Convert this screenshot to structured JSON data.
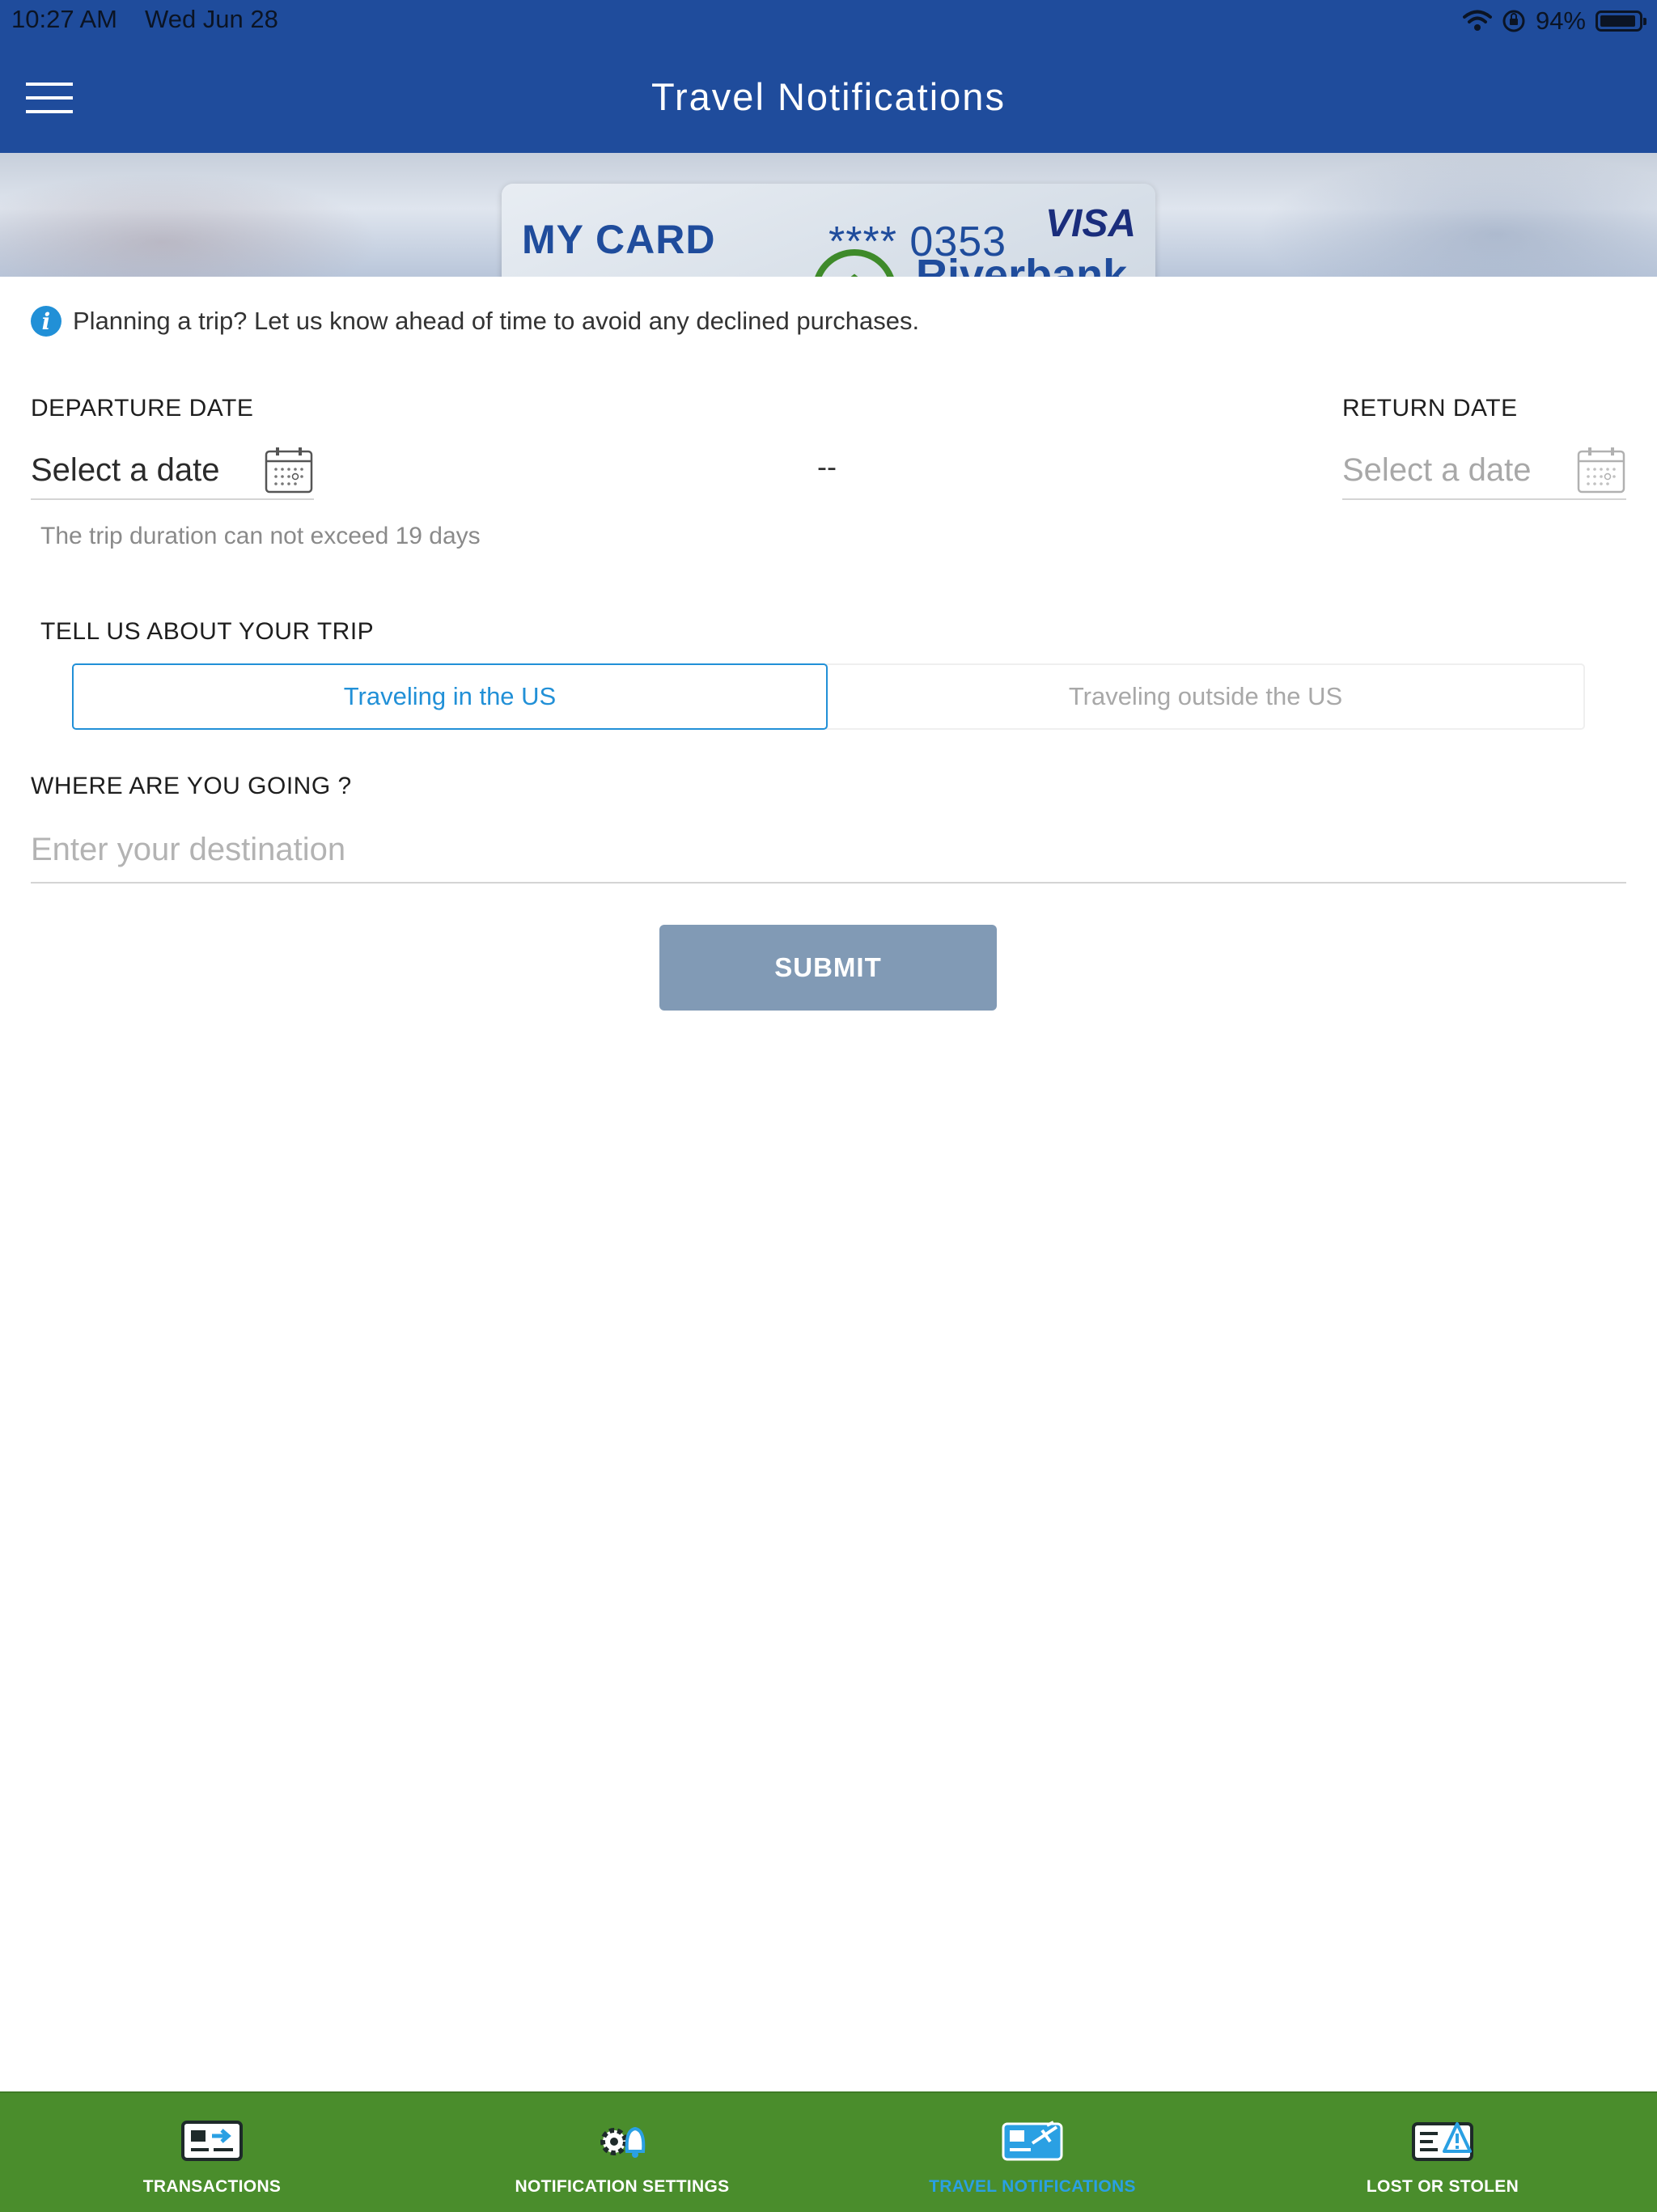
{
  "status_bar": {
    "time": "10:27 AM",
    "date": "Wed Jun 28",
    "battery": "94%",
    "battery_level": 0.94
  },
  "header": {
    "title": "Travel Notifications"
  },
  "card": {
    "label": "MY CARD",
    "number": "**** 0353",
    "brand": "VISA",
    "bank": "Riverbank"
  },
  "info": {
    "text": "Planning a trip? Let us know ahead of time to avoid any declined purchases."
  },
  "departure": {
    "label": "DEPARTURE DATE",
    "value": "Select a date"
  },
  "separator": "--",
  "return": {
    "label": "RETURN DATE",
    "value": "Select a date"
  },
  "duration_hint": "The trip duration can not exceed 19 days",
  "trip": {
    "label": "TELL US ABOUT YOUR TRIP",
    "options": [
      "Traveling in the US",
      "Traveling outside the US"
    ],
    "selected": "Traveling in the US"
  },
  "destination": {
    "label": "WHERE ARE YOU GOING ?",
    "placeholder": "Enter your destination",
    "value": ""
  },
  "submit_label": "SUBMIT",
  "tabs": [
    {
      "label": "TRANSACTIONS",
      "icon": "transactions-icon",
      "active": false
    },
    {
      "label": "NOTIFICATION SETTINGS",
      "icon": "notification-settings-icon",
      "active": false
    },
    {
      "label": "TRAVEL NOTIFICATIONS",
      "icon": "travel-notifications-icon",
      "active": true
    },
    {
      "label": "LOST OR STOLEN",
      "icon": "lost-stolen-icon",
      "active": false
    }
  ],
  "colors": {
    "header": "#1f4c9c",
    "accent": "#2190d7",
    "submit": "#819ab5",
    "tabbar": "#4a8d2c",
    "tab_active": "#2aa0e3"
  }
}
